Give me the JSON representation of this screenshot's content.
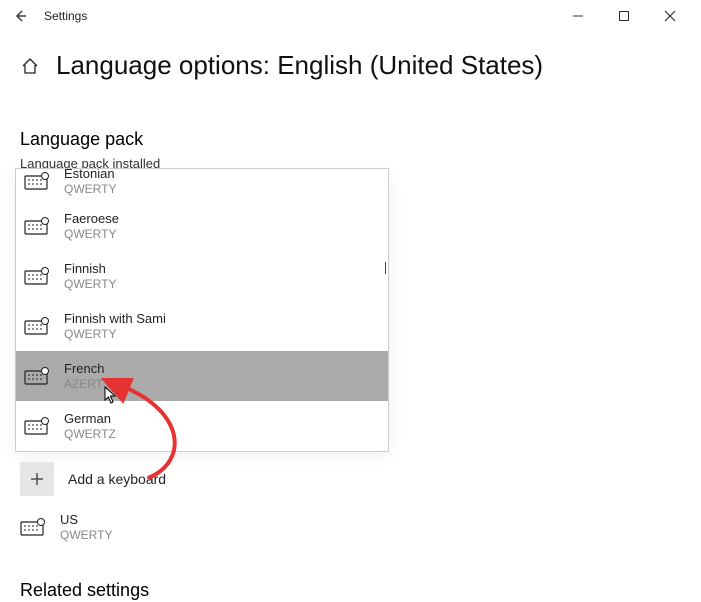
{
  "window": {
    "title": "Settings"
  },
  "page": {
    "title": "Language options: English (United States)"
  },
  "language_pack": {
    "heading": "Language pack",
    "status": "Language pack installed"
  },
  "keyboard_picker": {
    "items": [
      {
        "name": "Estonian",
        "layout": "QWERTY"
      },
      {
        "name": "Faeroese",
        "layout": "QWERTY"
      },
      {
        "name": "Finnish",
        "layout": "QWERTY"
      },
      {
        "name": "Finnish with Sami",
        "layout": "QWERTY"
      },
      {
        "name": "French",
        "layout": "AZERTY"
      },
      {
        "name": "German",
        "layout": "QWERTZ"
      }
    ],
    "selected_index": 4
  },
  "add_keyboard": {
    "label": "Add a keyboard"
  },
  "current_keyboard": {
    "name": "US",
    "layout": "QWERTY"
  },
  "related": {
    "heading": "Related settings"
  },
  "colors": {
    "selection": "#aaaaaa",
    "annotation": "#e63232"
  }
}
